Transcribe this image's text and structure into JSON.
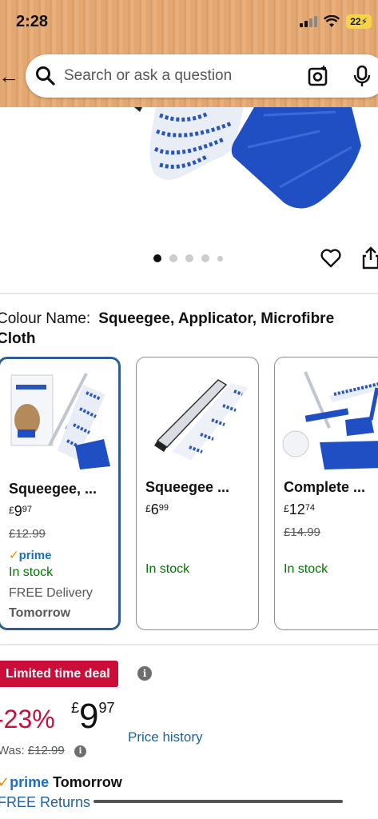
{
  "status_bar": {
    "time": "2:28",
    "battery": "22"
  },
  "search": {
    "placeholder": "Search or ask a question"
  },
  "carousel": {
    "dot_count": 5,
    "active_index": 0
  },
  "colour": {
    "label": "Colour Name:",
    "value": "Squeegee, Applicator, Microfibre Cloth"
  },
  "options": [
    {
      "title": "Squeegee, ...",
      "price_currency": "£",
      "price_whole": "9",
      "price_fraction": "97",
      "was": "£12.99",
      "prime": "prime",
      "stock": "In stock",
      "delivery": "FREE Delivery",
      "delivery_day": "Tomorrow",
      "selected": true
    },
    {
      "title": "Squeegee ...",
      "price_currency": "£",
      "price_whole": "6",
      "price_fraction": "99",
      "stock": "In stock",
      "selected": false
    },
    {
      "title": "Complete ...",
      "price_currency": "£",
      "price_whole": "12",
      "price_fraction": "74",
      "was": "£14.99",
      "stock": "In stock",
      "selected": false
    }
  ],
  "deal": {
    "badge": "Limited time deal",
    "discount": "-23%",
    "price_currency": "£",
    "price_whole": "9",
    "price_fraction": "97",
    "price_history": "Price history",
    "was_label": "Was:",
    "was_value": "£12.99"
  },
  "delivery": {
    "prime": "prime",
    "day": "Tomorrow",
    "returns": "FREE Returns"
  },
  "colors": {
    "deal_red": "#cc0c39",
    "prime_blue": "#1a6fc4",
    "stock_green": "#007600",
    "link_blue": "#2162a1",
    "selected_border": "#2e5f94"
  }
}
